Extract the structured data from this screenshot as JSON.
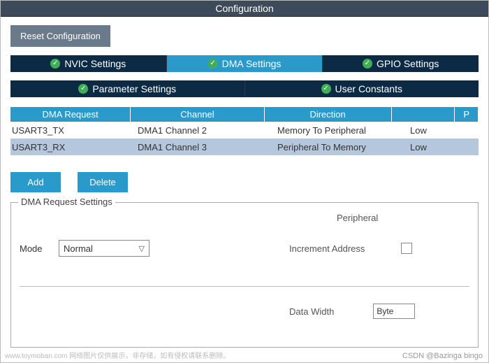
{
  "title": "Configuration",
  "reset_label": "Reset Configuration",
  "tabs_top": [
    {
      "label": "NVIC Settings",
      "active": false
    },
    {
      "label": "DMA Settings",
      "active": true
    },
    {
      "label": "GPIO Settings",
      "active": false
    }
  ],
  "tabs_bottom": [
    {
      "label": "Parameter Settings"
    },
    {
      "label": "User Constants"
    }
  ],
  "table": {
    "headers": [
      "DMA Request",
      "Channel",
      "Direction",
      "P"
    ],
    "extra_header": "P",
    "rows": [
      {
        "request": "USART3_TX",
        "channel": "DMA1 Channel 2",
        "direction": "Memory To Peripheral",
        "priority": "Low",
        "selected": false
      },
      {
        "request": "USART3_RX",
        "channel": "DMA1 Channel 3",
        "direction": "Peripheral To Memory",
        "priority": "Low",
        "selected": true
      }
    ]
  },
  "buttons": {
    "add": "Add",
    "delete": "Delete"
  },
  "fieldset": {
    "legend": "DMA Request Settings",
    "peripheral_label": "Peripheral",
    "mode_label": "Mode",
    "mode_value": "Normal",
    "increment_label": "Increment Address",
    "increment_checked": false,
    "data_width_label": "Data Width",
    "data_width_value": "Byte"
  },
  "watermarks": {
    "left": "www.toymoban.com 网络图片仅供展示，非存储，如有侵权请联系删除。",
    "right": "CSDN @Bazinga bingo"
  }
}
